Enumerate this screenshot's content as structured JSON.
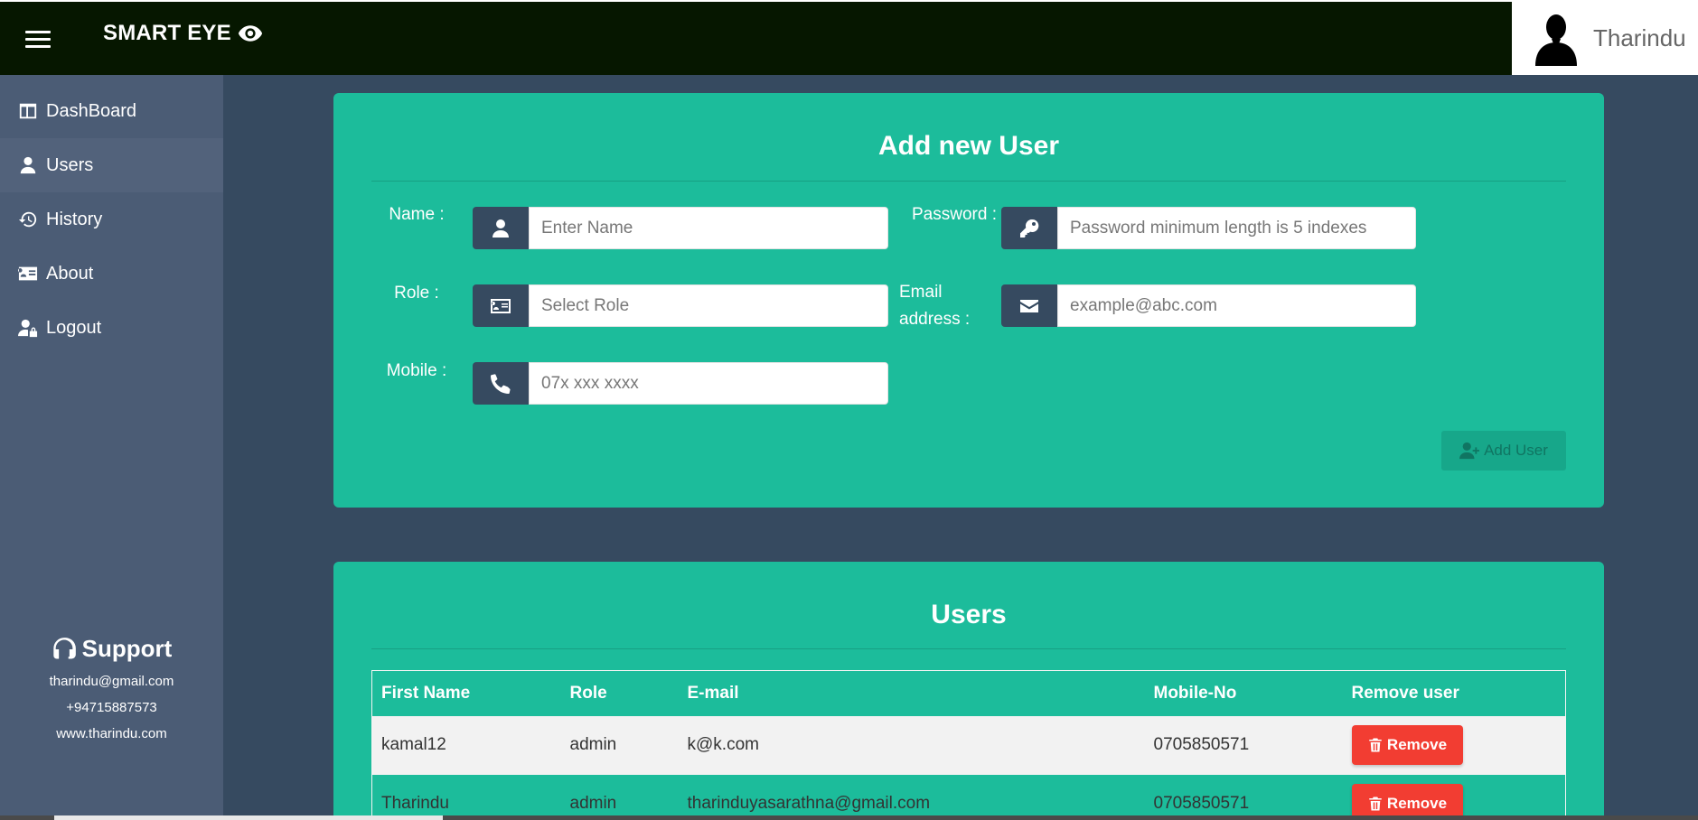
{
  "header": {
    "brand": "SMART EYE",
    "user_name": "Tharindu"
  },
  "sidebar": {
    "items": [
      {
        "label": "DashBoard",
        "icon": "dashboard-icon"
      },
      {
        "label": "Users",
        "icon": "user-icon"
      },
      {
        "label": "History",
        "icon": "history-icon"
      },
      {
        "label": "About",
        "icon": "id-card-icon"
      },
      {
        "label": "Logout",
        "icon": "user-lock-icon"
      }
    ],
    "support": {
      "title": "Support",
      "email": "tharindu@gmail.com",
      "phone": "+94715887573",
      "website": "www.tharindu.com"
    }
  },
  "add_user": {
    "title": "Add new User",
    "name_label": "Name :",
    "name_placeholder": "Enter Name",
    "password_label": "Password :",
    "password_placeholder": "Password minimum length is 5 indexes",
    "role_label": "Role :",
    "role_placeholder": "Select Role",
    "email_label": "Email address :",
    "email_placeholder": "example@abc.com",
    "mobile_label": "Mobile :",
    "mobile_placeholder": "07x xxx xxxx",
    "button": "Add User"
  },
  "users": {
    "title": "Users",
    "columns": [
      "First Name",
      "Role",
      "E-mail",
      "Mobile-No",
      "Remove user"
    ],
    "rows": [
      {
        "first_name": "kamal12",
        "role": "admin",
        "email": "k@k.com",
        "mobile": "0705850571",
        "action": "Remove"
      },
      {
        "first_name": "Tharindu",
        "role": "admin",
        "email": "tharinduyasarathna@gmail.com",
        "mobile": "0705850571",
        "action": "Remove"
      }
    ]
  },
  "colors": {
    "topbar": "#061700",
    "sidebar": "#4b5c75",
    "background": "#364a60",
    "card": "#1cbc9b",
    "remove": "#f23d32"
  }
}
